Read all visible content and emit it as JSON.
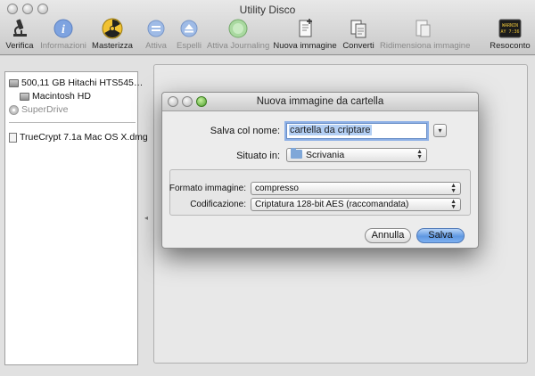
{
  "window": {
    "title": "Utility Disco"
  },
  "toolbar": {
    "items": [
      {
        "label": "Verifica",
        "icon": "microscope-icon",
        "enabled": true
      },
      {
        "label": "Informazioni",
        "icon": "info-icon",
        "enabled": false
      },
      {
        "label": "Masterizza",
        "icon": "burn-icon",
        "enabled": true
      },
      {
        "label": "Attiva",
        "icon": "mount-icon",
        "enabled": false
      },
      {
        "label": "Espelli",
        "icon": "eject-icon",
        "enabled": false
      },
      {
        "label": "Attiva Journaling",
        "icon": "journaling-icon",
        "enabled": false
      },
      {
        "label": "Nuova immagine",
        "icon": "new-image-icon",
        "enabled": true
      },
      {
        "label": "Converti",
        "icon": "convert-icon",
        "enabled": true
      },
      {
        "label": "Ridimensiona immagine",
        "icon": "resize-image-icon",
        "enabled": false
      },
      {
        "label": "Resoconto",
        "icon": "log-icon",
        "enabled": true
      }
    ],
    "log_icon_text": "WARNIN\nAY 7:36"
  },
  "sidebar": {
    "items": [
      {
        "label": "500,11 GB Hitachi HTS545…",
        "icon": "hard-drive-icon",
        "dim": false
      },
      {
        "label": "Macintosh HD",
        "icon": "volume-icon",
        "dim": false
      },
      {
        "label": "SuperDrive",
        "icon": "superdrive-icon",
        "dim": true
      },
      {
        "label": "TrueCrypt 7.1a Mac OS X.dmg",
        "icon": "dmg-icon",
        "dim": false
      }
    ]
  },
  "dialog": {
    "title": "Nuova immagine da cartella",
    "save_as_label": "Salva col nome:",
    "save_as_value": "cartella da criptare",
    "location_label": "Situato in:",
    "location_value": "Scrivania",
    "format_label": "Formato immagine:",
    "format_value": "compresso",
    "encryption_label": "Codificazione:",
    "encryption_value": "Criptatura 128-bit AES (raccomandata)",
    "cancel_label": "Annulla",
    "save_label": "Salva",
    "accent_color": "#5f98e2"
  }
}
